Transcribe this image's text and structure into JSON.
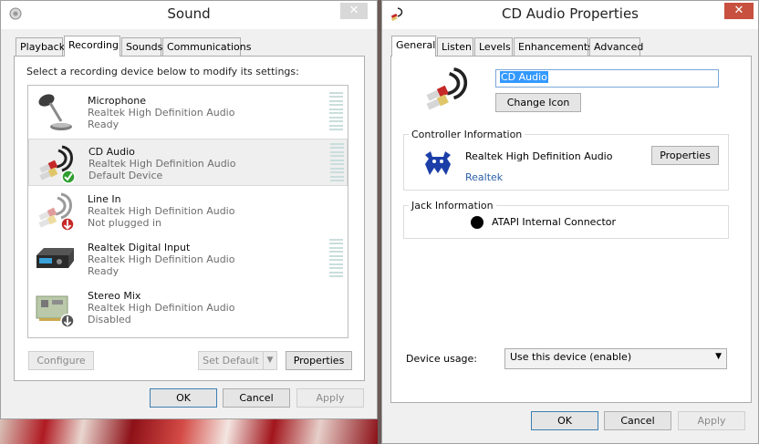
{
  "sound_window": {
    "title": "Sound",
    "close_label": "✕",
    "tabs": [
      "Playback",
      "Recording",
      "Sounds",
      "Communications"
    ],
    "active_tab": "Recording",
    "instruction": "Select a recording device below to modify its settings:",
    "devices": [
      {
        "name": "Microphone",
        "driver": "Realtek High Definition Audio",
        "status": "Ready",
        "icon": "microphone-icon",
        "selected": false,
        "meter": true
      },
      {
        "name": "CD Audio",
        "driver": "Realtek High Definition Audio",
        "status": "Default Device",
        "icon": "rca-cable-icon",
        "selected": true,
        "meter": true,
        "badge": "default-check-icon"
      },
      {
        "name": "Line In",
        "driver": "Realtek High Definition Audio",
        "status": "Not plugged in",
        "icon": "rca-cable-icon",
        "selected": false,
        "meter": false,
        "badge": "unplugged-arrow-icon"
      },
      {
        "name": "Realtek Digital Input",
        "driver": "Realtek High Definition Audio",
        "status": "Ready",
        "icon": "digital-receiver-icon",
        "selected": false,
        "meter": true
      },
      {
        "name": "Stereo Mix",
        "driver": "Realtek High Definition Audio",
        "status": "Disabled",
        "icon": "sound-card-icon",
        "selected": false,
        "meter": false,
        "badge": "disabled-arrow-icon"
      }
    ],
    "buttons": {
      "configure": "Configure",
      "set_default": "Set Default",
      "properties": "Properties",
      "ok": "OK",
      "cancel": "Cancel",
      "apply": "Apply"
    }
  },
  "cd_window": {
    "title": "CD Audio Properties",
    "close_label": "✕",
    "tabs": [
      "General",
      "Listen",
      "Levels",
      "Enhancements",
      "Advanced"
    ],
    "active_tab": "General",
    "device_name_value": "CD Audio",
    "change_icon_label": "Change Icon",
    "controller": {
      "group_label": "Controller Information",
      "name": "Realtek High Definition Audio",
      "vendor_link": "Realtek",
      "properties_label": "Properties"
    },
    "jack": {
      "group_label": "Jack Information",
      "connector": "ATAPI Internal Connector",
      "color": "#000000"
    },
    "device_usage": {
      "label": "Device usage:",
      "value": "Use this device (enable)"
    },
    "buttons": {
      "ok": "OK",
      "cancel": "Cancel",
      "apply": "Apply"
    }
  },
  "colors": {
    "selection_blue": "#3399ff",
    "link_blue": "#2b5fa6",
    "close_red": "#c7503f",
    "check_green": "#2f9e2f"
  }
}
